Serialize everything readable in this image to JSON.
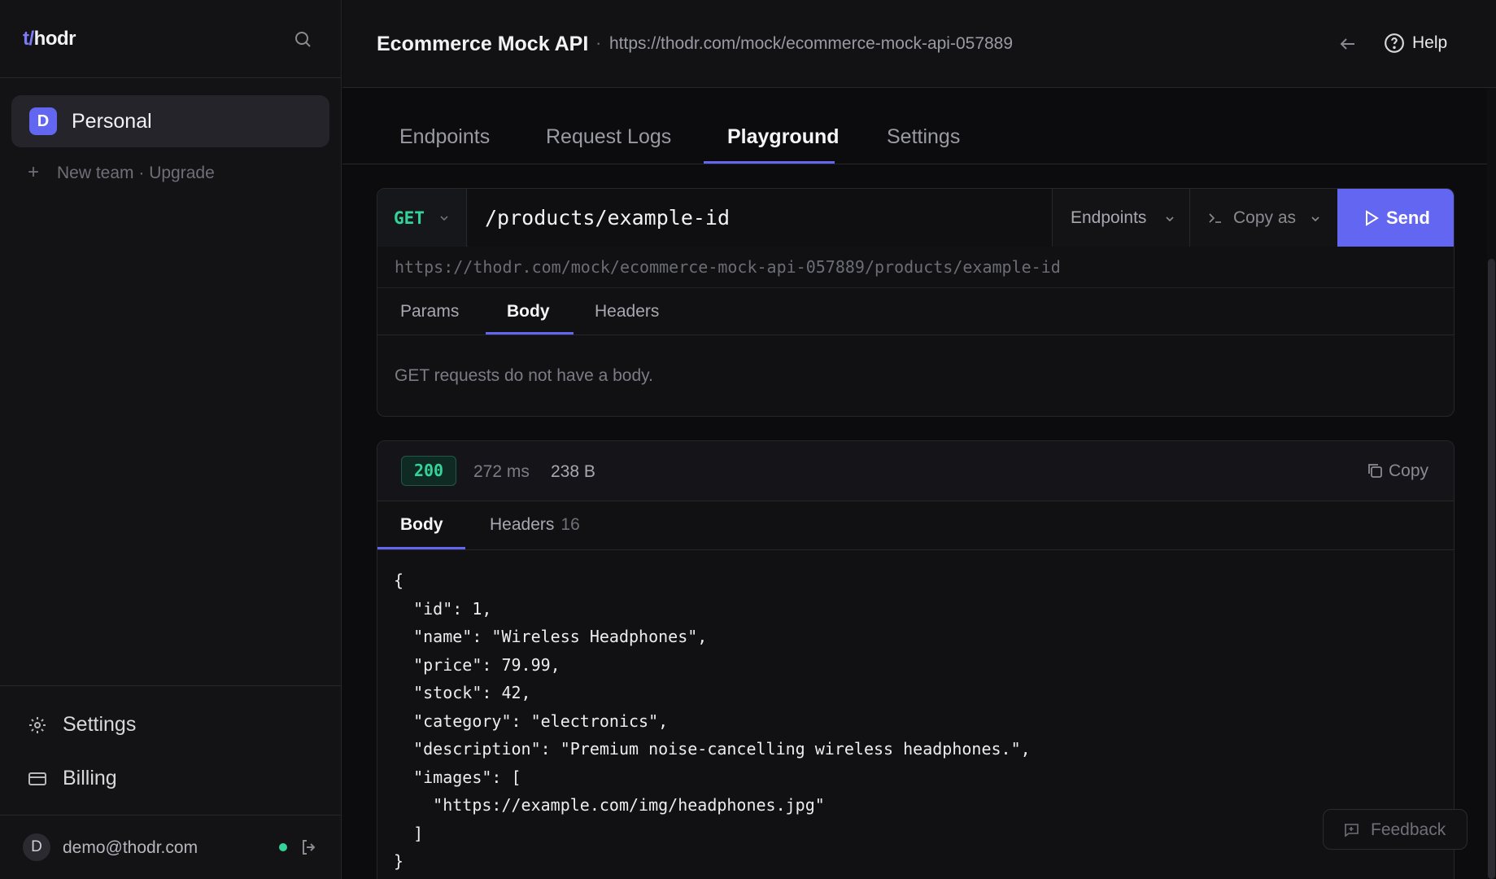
{
  "sidebar": {
    "logo_prefix": "t/",
    "logo_suffix": "hodr",
    "team": {
      "avatar": "D",
      "name": "Personal"
    },
    "new_team": "New team · Upgrade",
    "nav": [
      {
        "label": "Settings",
        "icon": "gear-icon"
      },
      {
        "label": "Billing",
        "icon": "credit-card-icon"
      }
    ],
    "user": {
      "avatar": "D",
      "email": "demo@thodr.com"
    }
  },
  "header": {
    "title": "Ecommerce Mock API",
    "separator": "·",
    "url": "https://thodr.com/mock/ecommerce-mock-api-057889",
    "help": "Help"
  },
  "tabs": [
    "Endpoints",
    "Request Logs",
    "Playground",
    "Settings"
  ],
  "active_tab": "Playground",
  "request": {
    "method": "GET",
    "path": "/products/example-id",
    "endpoints_label": "Endpoints",
    "copy_as_label": "Copy as",
    "send_label": "Send",
    "full_url": "https://thodr.com/mock/ecommerce-mock-api-057889/products/example-id",
    "subtabs": [
      "Params",
      "Body",
      "Headers"
    ],
    "active_subtab": "Body",
    "body_message": "GET requests do not have a body."
  },
  "response": {
    "status": "200",
    "time": "272 ms",
    "size": "238 B",
    "copy_label": "Copy",
    "tabs": {
      "body": "Body",
      "headers": "Headers",
      "headers_count": "16"
    },
    "body_lines": [
      "{",
      "  \"id\": 1,",
      "  \"name\": \"Wireless Headphones\",",
      "  \"price\": 79.99,",
      "  \"stock\": 42,",
      "  \"category\": \"electronics\",",
      "  \"description\": \"Premium noise-cancelling wireless headphones.\",",
      "  \"images\": [",
      "    \"https://example.com/img/headphones.jpg\"",
      "  ]",
      "}"
    ]
  },
  "feedback_label": "Feedback",
  "colors": {
    "accent": "#6366f1",
    "success": "#34d399",
    "background": "#0c0c0e",
    "sidebar": "#131316"
  }
}
